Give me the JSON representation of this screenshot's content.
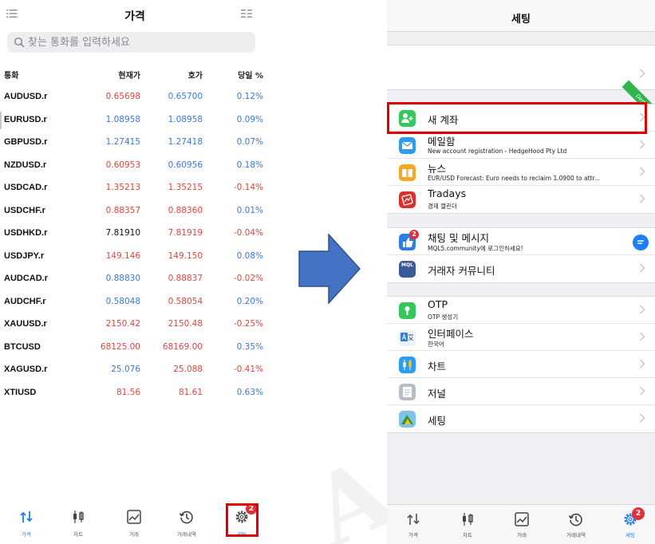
{
  "left": {
    "title": "가격",
    "search_placeholder": "찾는 통화를 입력하세요",
    "columns": {
      "symbol": "통화",
      "bid": "현재가",
      "ask": "호가",
      "change": "당일 %"
    },
    "rows": [
      {
        "symbol": "AUDUSD.r",
        "bid": "0.65698",
        "ask": "0.65700",
        "change": "0.12%",
        "bid_color": "#e0453c",
        "ask_color": "#3c78d8",
        "change_color": "#3c78d8"
      },
      {
        "symbol": "EURUSD.r",
        "bid": "1.08958",
        "ask": "1.08958",
        "change": "0.09%",
        "bid_color": "#3c78d8",
        "ask_color": "#3c78d8",
        "change_color": "#3c78d8"
      },
      {
        "symbol": "GBPUSD.r",
        "bid": "1.27415",
        "ask": "1.27418",
        "change": "0.07%",
        "bid_color": "#3c78d8",
        "ask_color": "#3c78d8",
        "change_color": "#3c78d8"
      },
      {
        "symbol": "NZDUSD.r",
        "bid": "0.60953",
        "ask": "0.60956",
        "change": "0.18%",
        "bid_color": "#e0453c",
        "ask_color": "#3c78d8",
        "change_color": "#3c78d8"
      },
      {
        "symbol": "USDCAD.r",
        "bid": "1.35213",
        "ask": "1.35215",
        "change": "-0.14%",
        "bid_color": "#e0453c",
        "ask_color": "#e0453c",
        "change_color": "#e0453c"
      },
      {
        "symbol": "USDCHF.r",
        "bid": "0.88357",
        "ask": "0.88360",
        "change": "0.01%",
        "bid_color": "#e0453c",
        "ask_color": "#e0453c",
        "change_color": "#3c78d8"
      },
      {
        "symbol": "USDHKD.r",
        "bid": "7.81910",
        "ask": "7.81919",
        "change": "-0.04%",
        "bid_color": "#111111",
        "ask_color": "#e0453c",
        "change_color": "#e0453c"
      },
      {
        "symbol": "USDJPY.r",
        "bid": "149.146",
        "ask": "149.150",
        "change": "0.08%",
        "bid_color": "#e0453c",
        "ask_color": "#e0453c",
        "change_color": "#3c78d8"
      },
      {
        "symbol": "AUDCAD.r",
        "bid": "0.88830",
        "ask": "0.88837",
        "change": "-0.02%",
        "bid_color": "#3c78d8",
        "ask_color": "#e0453c",
        "change_color": "#e0453c"
      },
      {
        "symbol": "AUDCHF.r",
        "bid": "0.58048",
        "ask": "0.58054",
        "change": "0.20%",
        "bid_color": "#3c78d8",
        "ask_color": "#e0453c",
        "change_color": "#3c78d8"
      },
      {
        "symbol": "XAUUSD.r",
        "bid": "2150.42",
        "ask": "2150.48",
        "change": "-0.25%",
        "bid_color": "#e0453c",
        "ask_color": "#e0453c",
        "change_color": "#e0453c"
      },
      {
        "symbol": "BTCUSD",
        "bid": "68125.00",
        "ask": "68169.00",
        "change": "0.35%",
        "bid_color": "#e0453c",
        "ask_color": "#e0453c",
        "change_color": "#3c78d8"
      },
      {
        "symbol": "XAGUSD.r",
        "bid": "25.076",
        "ask": "25.088",
        "change": "-0.41%",
        "bid_color": "#3c78d8",
        "ask_color": "#e0453c",
        "change_color": "#e0453c"
      },
      {
        "symbol": "XTIUSD",
        "bid": "81.56",
        "ask": "81.61",
        "change": "0.63%",
        "bid_color": "#e0453c",
        "ask_color": "#e0453c",
        "change_color": "#3c78d8"
      }
    ],
    "tabs": [
      {
        "label": "가격",
        "icon": "quotes-arrows-icon"
      },
      {
        "label": "차트",
        "icon": "candlestick-icon"
      },
      {
        "label": "거래",
        "icon": "trade-chart-icon"
      },
      {
        "label": "거래내역",
        "icon": "history-clock-icon"
      },
      {
        "label": "세팅",
        "icon": "gear-icon"
      }
    ],
    "settings_badge": "2"
  },
  "right": {
    "title": "세팅",
    "demo_label": "Demo",
    "new_account": "새 계좌",
    "mailbox": {
      "title": "메일함",
      "subtitle": "New account registration - HedgeHood Pty Ltd"
    },
    "news": {
      "title": "뉴스",
      "subtitle": "EUR/USD Forecast: Euro needs to reclaim 1.0900 to attr..."
    },
    "tradays": {
      "title": "Tradays",
      "subtitle": "경제 캘린더"
    },
    "chat": {
      "title": "채팅 및 메시지",
      "subtitle": "MQL5.community에 로그인하세요!",
      "badge": "2"
    },
    "community": {
      "title": "거래자 커뮤니티",
      "icon_text": "MQL"
    },
    "otp": {
      "title": "OTP",
      "subtitle": "OTP 생성기"
    },
    "interface": {
      "title": "인터페이스",
      "subtitle": "한국어"
    },
    "charts": "차트",
    "journal": "저널",
    "settings": "세팅",
    "tabs": [
      {
        "label": "가격"
      },
      {
        "label": "차트"
      },
      {
        "label": "거래"
      },
      {
        "label": "거래내역"
      },
      {
        "label": "세팅"
      }
    ],
    "settings_badge": "2"
  },
  "colors": {
    "accent": "#1d7ef7",
    "highlight": "#e00000",
    "arrow_fill": "#4472c4",
    "arrow_stroke": "#2f528f"
  }
}
